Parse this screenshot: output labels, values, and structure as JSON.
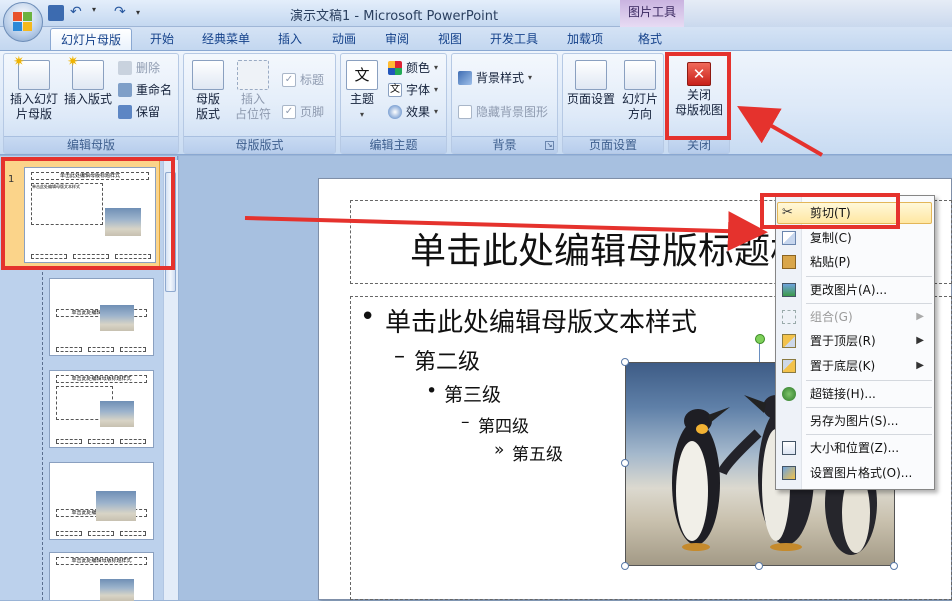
{
  "window": {
    "title": "演示文稿1 - Microsoft PowerPoint",
    "context_tool": "图片工具"
  },
  "tabs": [
    "幻灯片母版",
    "开始",
    "经典菜单",
    "插入",
    "动画",
    "审阅",
    "视图",
    "开发工具",
    "加载项",
    "格式"
  ],
  "active_tab": "幻灯片母版",
  "ribbon": {
    "edit_master": {
      "label": "编辑母版",
      "insert_slide_master": "插入幻灯\n片母版",
      "insert_layout": "插入版式",
      "delete": "删除",
      "rename": "重命名",
      "preserve": "保留"
    },
    "master_layout": {
      "label": "母版版式",
      "master_layout_btn": "母版\n版式",
      "insert_placeholder": "插入\n占位符",
      "title_check": "标题",
      "footer_check": "页脚"
    },
    "edit_theme": {
      "label": "编辑主题",
      "themes": "主题",
      "colors": "颜色",
      "fonts": "字体",
      "effects": "效果",
      "fonts_glyph": "文"
    },
    "background": {
      "label": "背景",
      "bg_styles": "背景样式",
      "hide_bg": "隐藏背景图形"
    },
    "page_setup": {
      "label": "页面设置",
      "page_setup_btn": "页面设置",
      "orientation": "幻灯片\n方向"
    },
    "close": {
      "label": "关闭",
      "close_master": "关闭\n母版视图"
    }
  },
  "thumb_panel": {
    "selected_number": "1",
    "thumb_title": "单击此处编辑母版标题样式",
    "thumb_body": "单击此处编辑母版文本样式"
  },
  "slide": {
    "title": "单击此处编辑母版标题样式",
    "levels": [
      {
        "bullet": "•",
        "text": "单击此处编辑母版文本样式"
      },
      {
        "bullet": "–",
        "text": "第二级"
      },
      {
        "bullet": "•",
        "text": "第三级"
      },
      {
        "bullet": "–",
        "text": "第四级"
      },
      {
        "bullet": "»",
        "text": "第五级"
      }
    ]
  },
  "context_menu": [
    {
      "label": "剪切(T)",
      "icon": "scissors-icon",
      "highlighted": true
    },
    {
      "label": "复制(C)",
      "icon": "copy-icon"
    },
    {
      "label": "粘贴(P)",
      "icon": "paste-icon"
    },
    {
      "label": "更改图片(A)...",
      "icon": "change-picture-icon"
    },
    {
      "label": "组合(G)",
      "icon": "group-icon",
      "disabled": true,
      "submenu": true
    },
    {
      "label": "置于顶层(R)",
      "icon": "bring-front-icon",
      "submenu": true
    },
    {
      "label": "置于底层(K)",
      "icon": "send-back-icon",
      "submenu": true
    },
    {
      "label": "超链接(H)...",
      "icon": "hyperlink-icon"
    },
    {
      "label": "另存为图片(S)...",
      "icon": "save-picture-icon"
    },
    {
      "label": "大小和位置(Z)...",
      "icon": "size-position-icon"
    },
    {
      "label": "设置图片格式(O)...",
      "icon": "format-picture-icon"
    }
  ],
  "colors": {
    "annotation_red": "#e5322d",
    "ribbon_blue": "#dde9f8",
    "menu_highlight": "#ffe7a2"
  }
}
